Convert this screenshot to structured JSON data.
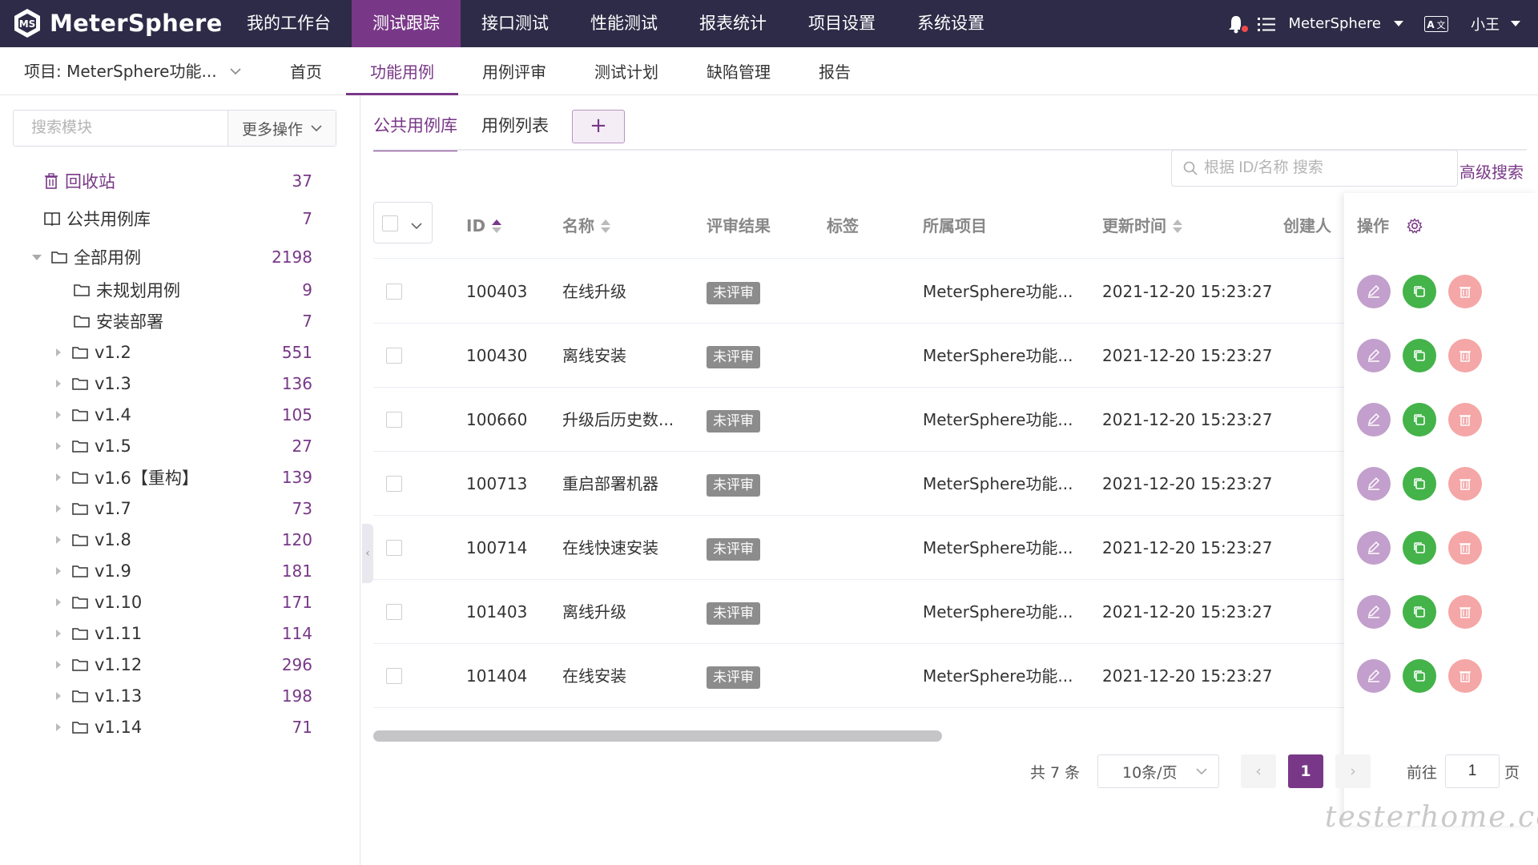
{
  "app": {
    "name": "MeterSphere"
  },
  "topnav": {
    "items": [
      "我的工作台",
      "测试跟踪",
      "接口测试",
      "性能测试",
      "报表统计",
      "项目设置",
      "系统设置"
    ],
    "active_index": 1,
    "workspace": "MeterSphere",
    "user": "小王"
  },
  "subnav": {
    "project": "项目: MeterSphere功能...",
    "tabs": [
      "首页",
      "功能用例",
      "用例评审",
      "测试计划",
      "缺陷管理",
      "报告"
    ],
    "active_index": 1
  },
  "sidebar": {
    "search_placeholder": "搜索模块",
    "more_label": "更多操作",
    "special": [
      {
        "label": "回收站",
        "count": "37",
        "icon": "trash-icon"
      },
      {
        "label": "公共用例库",
        "count": "7",
        "icon": "book-icon"
      }
    ],
    "root": {
      "label": "全部用例",
      "count": "2198"
    },
    "nodes": [
      {
        "label": "未规划用例",
        "count": "9",
        "expandable": false
      },
      {
        "label": "安装部署",
        "count": "7",
        "expandable": false
      },
      {
        "label": "v1.2",
        "count": "551",
        "expandable": true
      },
      {
        "label": "v1.3",
        "count": "136",
        "expandable": true
      },
      {
        "label": "v1.4",
        "count": "105",
        "expandable": true
      },
      {
        "label": "v1.5",
        "count": "27",
        "expandable": true
      },
      {
        "label": "v1.6【重构】",
        "count": "139",
        "expandable": true
      },
      {
        "label": "v1.7",
        "count": "73",
        "expandable": true
      },
      {
        "label": "v1.8",
        "count": "120",
        "expandable": true
      },
      {
        "label": "v1.9",
        "count": "181",
        "expandable": true
      },
      {
        "label": "v1.10",
        "count": "171",
        "expandable": true
      },
      {
        "label": "v1.11",
        "count": "114",
        "expandable": true
      },
      {
        "label": "v1.12",
        "count": "296",
        "expandable": true
      },
      {
        "label": "v1.13",
        "count": "198",
        "expandable": true
      },
      {
        "label": "v1.14",
        "count": "71",
        "expandable": true
      }
    ]
  },
  "main": {
    "tabs": [
      "公共用例库",
      "用例列表"
    ],
    "active_tab": 0,
    "add_label": "+",
    "search_placeholder": "根据 ID/名称 搜索",
    "advanced_search": "高级搜索",
    "columns": {
      "id": "ID",
      "name": "名称",
      "review": "评审结果",
      "tags": "标签",
      "project": "所属项目",
      "updated": "更新时间",
      "creator": "创建人",
      "ops": "操作"
    },
    "rows": [
      {
        "id": "100403",
        "name": "在线升级",
        "review": "未评审",
        "project": "MeterSphere功能...",
        "updated": "2021-12-20 15:23:27"
      },
      {
        "id": "100430",
        "name": "离线安装",
        "review": "未评审",
        "project": "MeterSphere功能...",
        "updated": "2021-12-20 15:23:27"
      },
      {
        "id": "100660",
        "name": "升级后历史数...",
        "review": "未评审",
        "project": "MeterSphere功能...",
        "updated": "2021-12-20 15:23:27"
      },
      {
        "id": "100713",
        "name": "重启部署机器",
        "review": "未评审",
        "project": "MeterSphere功能...",
        "updated": "2021-12-20 15:23:27"
      },
      {
        "id": "100714",
        "name": "在线快速安装",
        "review": "未评审",
        "project": "MeterSphere功能...",
        "updated": "2021-12-20 15:23:27"
      },
      {
        "id": "101403",
        "name": "离线升级",
        "review": "未评审",
        "project": "MeterSphere功能...",
        "updated": "2021-12-20 15:23:27"
      },
      {
        "id": "101404",
        "name": "在线安装",
        "review": "未评审",
        "project": "MeterSphere功能...",
        "updated": "2021-12-20 15:23:27"
      }
    ],
    "pagination": {
      "total": "共 7 条",
      "page_size": "10条/页",
      "current_page": "1",
      "goto_label": "前往",
      "goto_value": "1",
      "page_suffix": "页"
    }
  },
  "watermark": "testerhome.com",
  "colors": {
    "brand": "#783887",
    "topbar": "#2d2b47",
    "copy": "#44b349",
    "delete": "#f5a6a6",
    "edit": "#c29fcc"
  }
}
